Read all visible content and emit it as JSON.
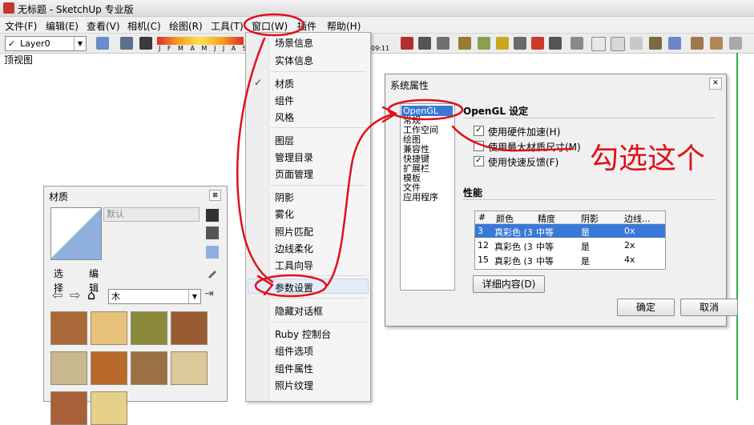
{
  "window": {
    "title": "无标题 - SketchUp 专业版"
  },
  "menubar": {
    "items": [
      {
        "label": "文件(F)",
        "name": "menu-file"
      },
      {
        "label": "编辑(E)",
        "name": "menu-edit"
      },
      {
        "label": "查看(V)",
        "name": "menu-view"
      },
      {
        "label": "相机(C)",
        "name": "menu-camera"
      },
      {
        "label": "绘图(R)",
        "name": "menu-draw"
      },
      {
        "label": "工具(T)",
        "name": "menu-tools"
      },
      {
        "label": "窗口(W)",
        "name": "menu-window"
      },
      {
        "label": "插件",
        "name": "menu-plugins"
      },
      {
        "label": "帮助(H)",
        "name": "menu-help"
      }
    ]
  },
  "toolbar": {
    "layer": "Layer0",
    "layer_check": "✓",
    "months": "J F M A M J J A S O N D",
    "time": "09:11"
  },
  "viewport": {
    "view_label": "顶视图"
  },
  "window_menu": {
    "items": [
      {
        "label": "场景信息",
        "checked": false
      },
      {
        "label": "实体信息",
        "checked": false
      },
      {
        "label": "材质",
        "checked": true
      },
      {
        "label": "组件",
        "checked": false
      },
      {
        "label": "风格",
        "checked": false
      },
      {
        "label": "图层",
        "checked": false
      },
      {
        "label": "管理目录",
        "checked": false
      },
      {
        "label": "页面管理",
        "checked": false
      },
      {
        "label": "阴影",
        "checked": false
      },
      {
        "label": "雾化",
        "checked": false
      },
      {
        "label": "照片匹配",
        "checked": false
      },
      {
        "label": "边线柔化",
        "checked": false
      },
      {
        "label": "工具向导",
        "checked": false
      },
      {
        "label": "参数设置",
        "checked": false,
        "highlighted": true
      },
      {
        "label": "隐藏对话框",
        "checked": false
      },
      {
        "label": "Ruby 控制台",
        "checked": false
      },
      {
        "label": "组件选项",
        "checked": false
      },
      {
        "label": "组件属性",
        "checked": false
      },
      {
        "label": "照片纹理",
        "checked": false
      }
    ],
    "check_glyph": "✓"
  },
  "dialog": {
    "title": "系统属性",
    "close_glyph": "✕",
    "nav_items": [
      "OpenGL",
      "常规",
      "工作空间",
      "绘图",
      "兼容性",
      "快捷键",
      "扩展栏",
      "模板",
      "文件",
      "应用程序"
    ],
    "selected_nav": "OpenGL",
    "opengl_title": "OpenGL 设定",
    "options": [
      {
        "label": "使用硬件加速(H)",
        "checked": true
      },
      {
        "label": "使用最大材质尺寸(M)",
        "checked": false
      },
      {
        "label": "使用快速反馈(F)",
        "checked": true
      }
    ],
    "perf_title": "性能",
    "perf_headers": [
      "#",
      "颜色",
      "精度",
      "阴影",
      "边线..."
    ],
    "perf_rows": [
      {
        "num": "3",
        "color": "真彩色 (3",
        "precision": "中等",
        "shadow": "是",
        "edge": "0x",
        "selected": true
      },
      {
        "num": "12",
        "color": "真彩色 (3",
        "precision": "中等",
        "shadow": "是",
        "edge": "2x",
        "selected": false
      },
      {
        "num": "15",
        "color": "真彩色 (3",
        "precision": "中等",
        "shadow": "是",
        "edge": "4x",
        "selected": false
      }
    ],
    "details_button": "详细内容(D)",
    "ok_button": "确定",
    "cancel_button": "取消"
  },
  "materials_panel": {
    "title": "材质",
    "close_glyph": "⊠",
    "name_placeholder": "默认",
    "tabs": [
      "选择",
      "编辑"
    ],
    "category": "木"
  },
  "annotation": {
    "text": "勾选这个",
    "color": "#e0101a"
  }
}
